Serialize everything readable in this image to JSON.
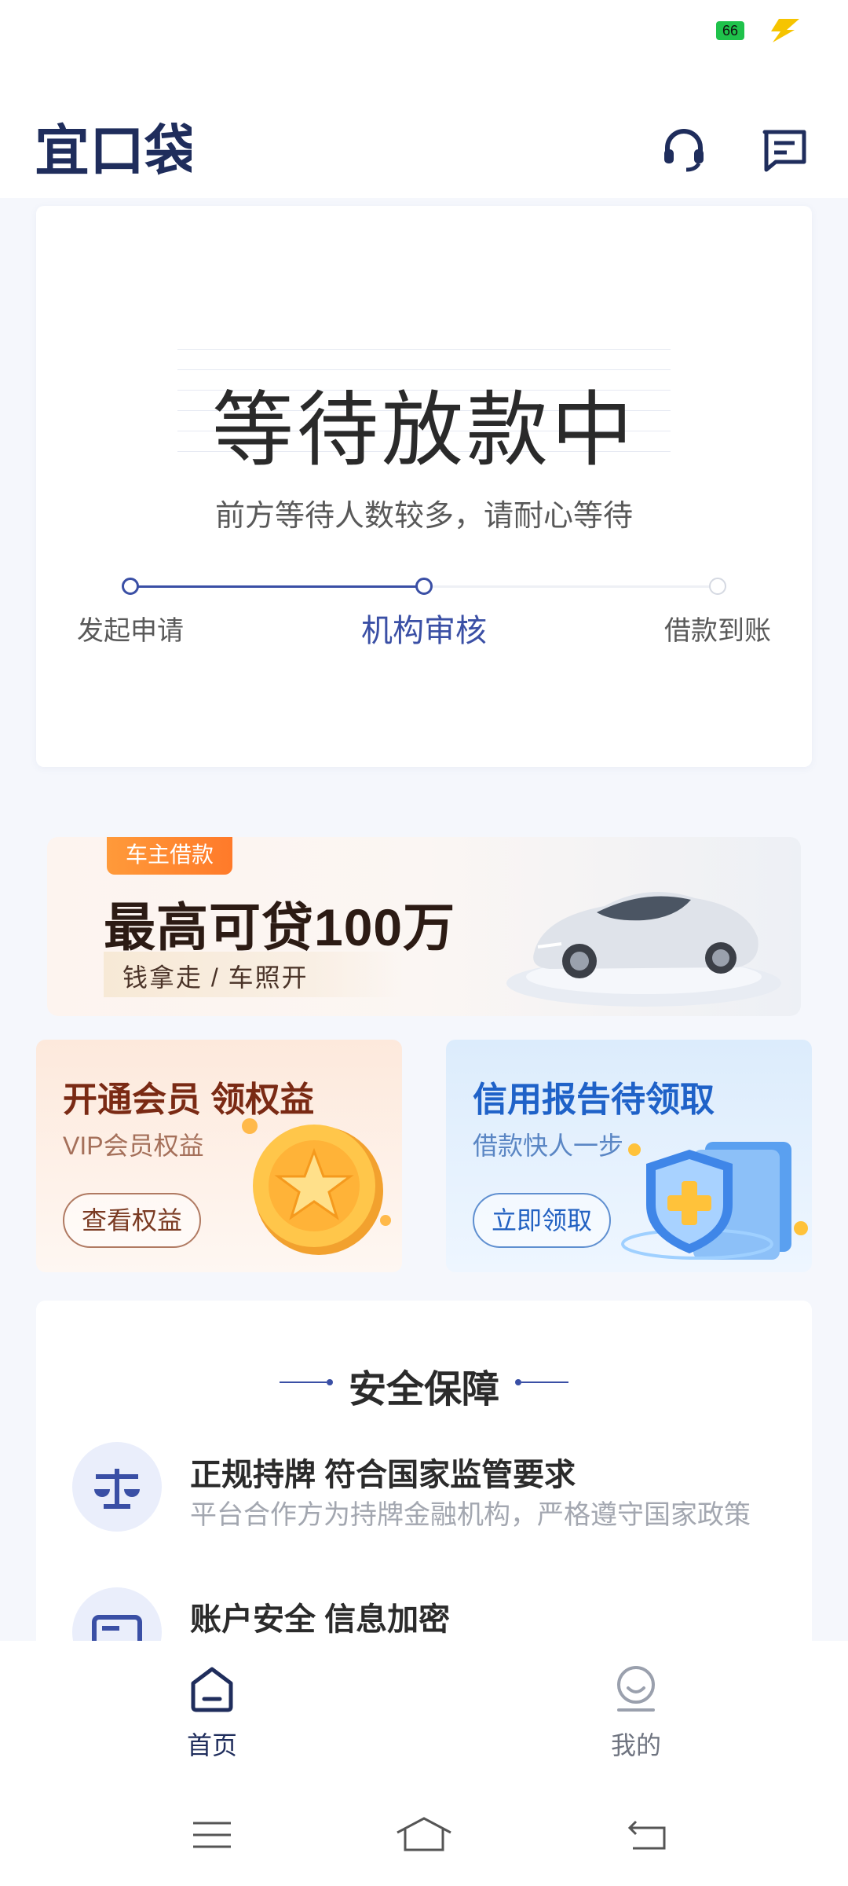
{
  "status_bar": {
    "battery_level": "66"
  },
  "header": {
    "logo_text": "宜口袋"
  },
  "loan_status": {
    "title": "等待放款中",
    "subtitle": "前方等待人数较多，请耐心等待",
    "steps": [
      {
        "label": "发起申请"
      },
      {
        "label": "机构审核"
      },
      {
        "label": "借款到账"
      }
    ]
  },
  "car_banner": {
    "tag": "车主借款",
    "headline": "最高可贷100万",
    "subtext": "钱拿走 / 车照开"
  },
  "promos": {
    "vip": {
      "title": "开通会员 领权益",
      "subtitle": "VIP会员权益",
      "button": "查看权益"
    },
    "credit": {
      "title": "信用报告待领取",
      "subtitle": "借款快人一步",
      "button": "立即领取"
    }
  },
  "security": {
    "title": "安全保障",
    "items": [
      {
        "title": "正规持牌 符合国家监管要求",
        "desc": "平台合作方为持牌金融机构，严格遵守国家政策"
      },
      {
        "title": "账户安全 信息加密",
        "desc": ""
      }
    ]
  },
  "bottom_nav": {
    "items": [
      {
        "label": "首页",
        "active": true
      },
      {
        "label": "我的",
        "active": false
      }
    ]
  },
  "colors": {
    "primary": "#3a4fa5",
    "navy": "#1f2d5c",
    "orange": "#ff8a30"
  }
}
